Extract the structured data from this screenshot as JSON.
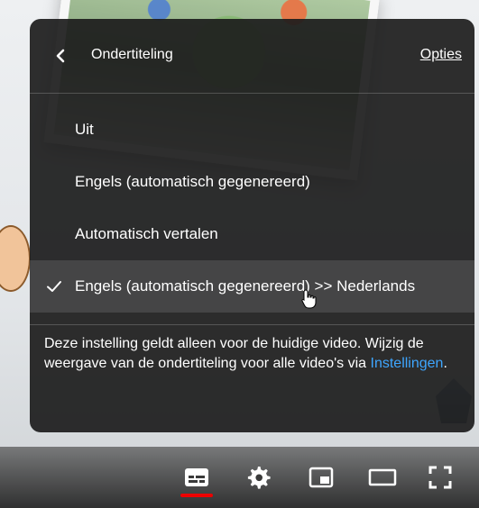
{
  "panel": {
    "title": "Ondertiteling",
    "options_label": "Opties",
    "items": [
      {
        "label": "Uit",
        "selected": false
      },
      {
        "label": "Engels (automatisch gegenereerd)",
        "selected": false
      },
      {
        "label": "Automatisch vertalen",
        "selected": false
      },
      {
        "label": "Engels (automatisch gegenereerd) >> Nederlands",
        "selected": true
      }
    ],
    "footer_text": "Deze instelling geldt alleen voor de huidige video. Wijzig de weergave van de ondertiteling voor alle video's via ",
    "footer_link": "Instellingen",
    "footer_end": "."
  },
  "controls": {
    "subtitles_icon": "subtitles-icon",
    "settings_icon": "gear-icon",
    "miniplayer_icon": "miniplayer-icon",
    "theater_icon": "theater-mode-icon",
    "fullscreen_icon": "fullscreen-icon"
  },
  "colors": {
    "panel_bg": "#1c1c1c",
    "link": "#3ea6ff",
    "active_underline": "#ee0000"
  }
}
